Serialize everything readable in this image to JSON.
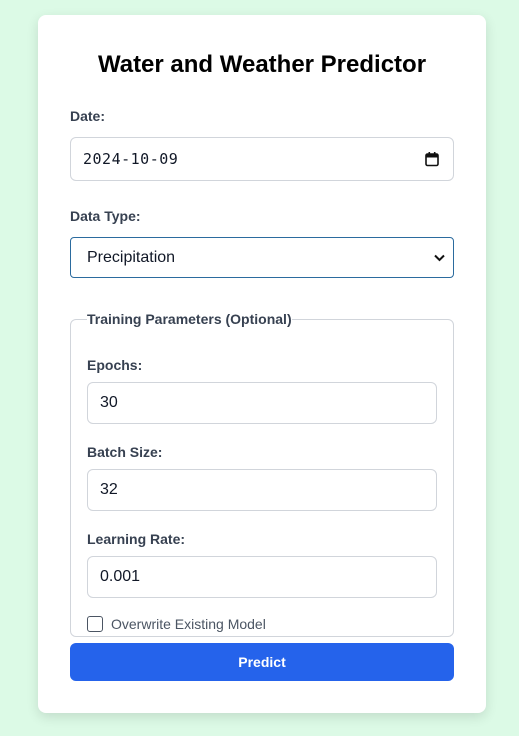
{
  "form": {
    "title": "Water and Weather Predictor",
    "date_label": "Date:",
    "date_value": "2024-10-09",
    "data_type_label": "Data Type:",
    "data_type_value": "Precipitation",
    "training": {
      "legend": "Training Parameters (Optional)",
      "epochs_label": "Epochs:",
      "epochs_value": "30",
      "batch_size_label": "Batch Size:",
      "batch_size_value": "32",
      "learning_rate_label": "Learning Rate:",
      "learning_rate_value": "0.001",
      "overwrite_label": "Overwrite Existing Model",
      "overwrite_checked": false
    },
    "predict_label": "Predict"
  },
  "icons": {
    "calendar": "calendar-icon",
    "chevron": "chevron-down-icon"
  },
  "colors": {
    "page_background": "#dcfae6",
    "accent": "#2563eb",
    "select_border": "#2b6b9e"
  }
}
